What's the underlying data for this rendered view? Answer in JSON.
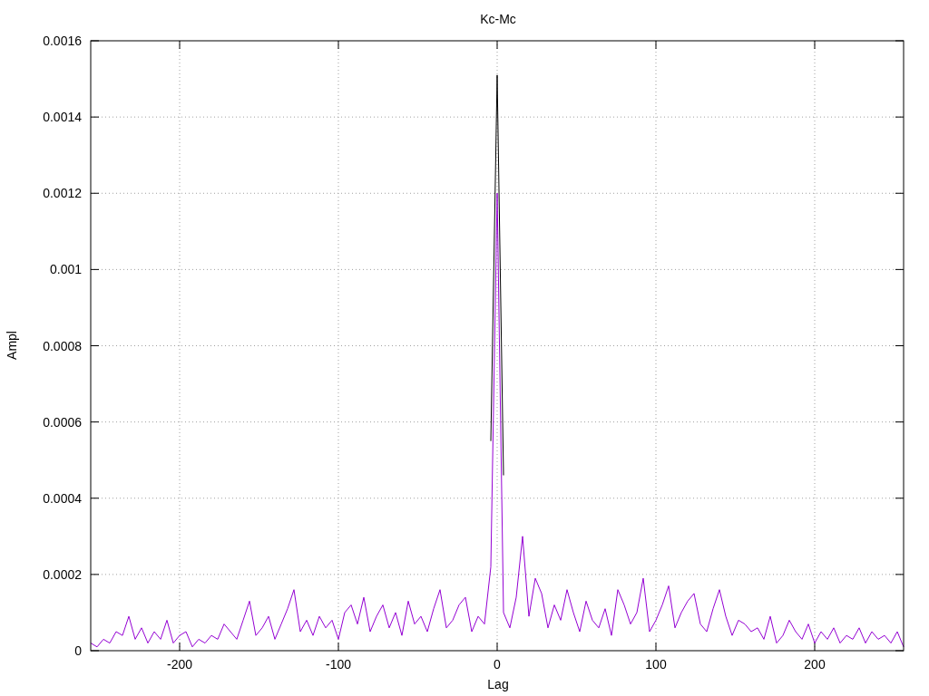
{
  "chart_data": {
    "type": "line",
    "title": "Kc-Mc",
    "xlabel": "Lag",
    "ylabel": "Ampl",
    "xlim": [
      -256,
      256
    ],
    "grid": true,
    "ylim": [
      0,
      0.0016
    ],
    "xticks": [
      -200,
      -100,
      0,
      100,
      200
    ],
    "yticks": [
      0,
      0.0002,
      0.0004,
      0.0006,
      0.0008,
      0.001,
      0.0012,
      0.0014,
      0.0016
    ],
    "x": [
      -256,
      -252,
      -248,
      -244,
      -240,
      -236,
      -232,
      -228,
      -224,
      -220,
      -216,
      -212,
      -208,
      -204,
      -200,
      -196,
      -192,
      -188,
      -184,
      -180,
      -176,
      -172,
      -168,
      -164,
      -160,
      -156,
      -152,
      -148,
      -144,
      -140,
      -136,
      -132,
      -128,
      -124,
      -120,
      -116,
      -112,
      -108,
      -104,
      -100,
      -96,
      -92,
      -88,
      -84,
      -80,
      -76,
      -72,
      -68,
      -64,
      -60,
      -56,
      -52,
      -48,
      -44,
      -40,
      -36,
      -32,
      -28,
      -24,
      -20,
      -16,
      -12,
      -8,
      -4,
      0,
      4,
      8,
      12,
      16,
      20,
      24,
      28,
      32,
      36,
      40,
      44,
      48,
      52,
      56,
      60,
      64,
      68,
      72,
      76,
      80,
      84,
      88,
      92,
      96,
      100,
      104,
      108,
      112,
      116,
      120,
      124,
      128,
      132,
      136,
      140,
      144,
      148,
      152,
      156,
      160,
      164,
      168,
      172,
      176,
      180,
      184,
      188,
      192,
      196,
      200,
      204,
      208,
      212,
      216,
      220,
      224,
      228,
      232,
      236,
      240,
      244,
      248,
      252,
      256
    ],
    "series": [
      {
        "color": "#000000",
        "values": [
          null,
          null,
          null,
          null,
          null,
          null,
          null,
          null,
          null,
          null,
          null,
          null,
          null,
          null,
          null,
          null,
          null,
          null,
          null,
          null,
          null,
          null,
          null,
          null,
          null,
          null,
          null,
          null,
          null,
          null,
          null,
          null,
          null,
          null,
          null,
          null,
          null,
          null,
          null,
          null,
          null,
          null,
          null,
          null,
          null,
          null,
          null,
          null,
          null,
          null,
          null,
          null,
          null,
          null,
          null,
          null,
          null,
          null,
          null,
          null,
          null,
          null,
          null,
          0.00055,
          0.00151,
          0.00046,
          null,
          null,
          null,
          null,
          null,
          null,
          null,
          null,
          null,
          null,
          null,
          null,
          null,
          null,
          null,
          null,
          null,
          null,
          null,
          null,
          null,
          null,
          null,
          null,
          null,
          null,
          null,
          null,
          null,
          null,
          null,
          null,
          null,
          null,
          null,
          null,
          null,
          null,
          null,
          null,
          null,
          null,
          null,
          null,
          null,
          null,
          null,
          null,
          null,
          null,
          null,
          null,
          null,
          null,
          null,
          null,
          null,
          null,
          null,
          null,
          null,
          null,
          null
        ]
      },
      {
        "color": "#9400d3",
        "values": [
          2e-05,
          1e-05,
          3e-05,
          2e-05,
          5e-05,
          4e-05,
          9e-05,
          3e-05,
          6e-05,
          2e-05,
          5e-05,
          3e-05,
          8e-05,
          2e-05,
          4e-05,
          5e-05,
          1e-05,
          3e-05,
          2e-05,
          4e-05,
          3e-05,
          7e-05,
          5e-05,
          3e-05,
          8e-05,
          0.00013,
          4e-05,
          6e-05,
          9e-05,
          3e-05,
          7e-05,
          0.00011,
          0.00016,
          5e-05,
          8e-05,
          4e-05,
          9e-05,
          6e-05,
          8e-05,
          3e-05,
          0.0001,
          0.00012,
          7e-05,
          0.00014,
          5e-05,
          9e-05,
          0.00012,
          6e-05,
          0.0001,
          4e-05,
          0.00013,
          7e-05,
          9e-05,
          5e-05,
          0.00011,
          0.00016,
          6e-05,
          8e-05,
          0.00012,
          0.00014,
          5e-05,
          9e-05,
          7e-05,
          0.00022,
          0.0012,
          0.0001,
          6e-05,
          0.00014,
          0.0003,
          9e-05,
          0.00019,
          0.00015,
          6e-05,
          0.00012,
          8e-05,
          0.00016,
          0.0001,
          5e-05,
          0.00013,
          8e-05,
          6e-05,
          0.00011,
          4e-05,
          0.00016,
          0.00012,
          7e-05,
          0.0001,
          0.00019,
          5e-05,
          8e-05,
          0.00012,
          0.00017,
          6e-05,
          0.0001,
          0.00013,
          0.00015,
          7e-05,
          5e-05,
          0.00011,
          0.00016,
          9e-05,
          4e-05,
          8e-05,
          7e-05,
          5e-05,
          6e-05,
          3e-05,
          9e-05,
          2e-05,
          4e-05,
          8e-05,
          5e-05,
          3e-05,
          7e-05,
          2e-05,
          5e-05,
          3e-05,
          6e-05,
          2e-05,
          4e-05,
          3e-05,
          6e-05,
          2e-05,
          5e-05,
          3e-05,
          4e-05,
          2e-05,
          5e-05,
          1e-05
        ]
      }
    ]
  }
}
